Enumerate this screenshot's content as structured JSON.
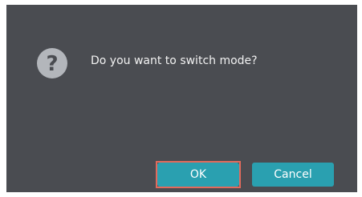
{
  "dialog": {
    "message": "Do you want to switch mode?",
    "icon": "question-mark-icon",
    "icon_glyph": "?",
    "ok_label": "OK",
    "cancel_label": "Cancel"
  },
  "colors": {
    "dialog_background": "#4a4c51",
    "button_background": "#2aa0b0",
    "highlight_border": "#e26a5c",
    "icon_background": "#b3b6bb"
  }
}
